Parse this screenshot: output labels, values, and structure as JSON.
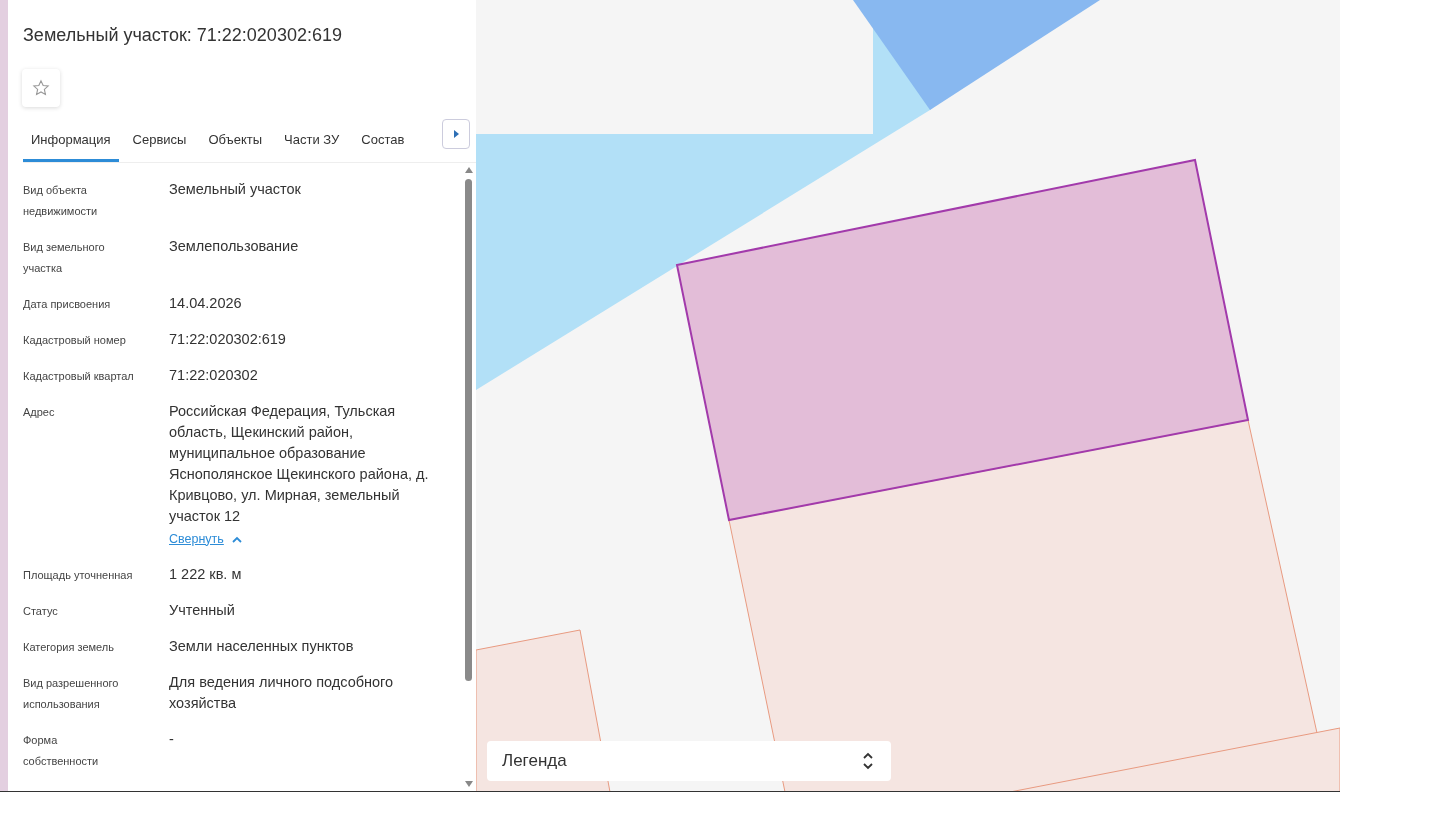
{
  "panel": {
    "title": "Земельный участок: 71:22:020302:619",
    "tabs": [
      {
        "label": "Информация",
        "selected": true
      },
      {
        "label": "Сервисы",
        "selected": false
      },
      {
        "label": "Объекты",
        "selected": false
      },
      {
        "label": "Части ЗУ",
        "selected": false
      },
      {
        "label": "Состав",
        "selected": false
      }
    ],
    "fields": [
      {
        "kind": "plain",
        "label": "Вид объекта недвижимости",
        "value": "Земельный участок"
      },
      {
        "kind": "plain",
        "label": "Вид земельного участка",
        "value": "Землепользование"
      },
      {
        "kind": "plain",
        "label": "Дата присвоения",
        "value": "14.04.2026"
      },
      {
        "kind": "plain",
        "label": "Кадастровый номер",
        "value": "71:22:020302:619"
      },
      {
        "kind": "plain",
        "label": "Кадастровый квартал",
        "value": "71:22:020302"
      },
      {
        "kind": "expandable",
        "label": "Адрес",
        "value": "Российская Федерация, Тульская область, Щекинский район, муниципальное образование Яснополянское Щекинского района, д. Кривцово, ул. Мирная, земельный участок 12",
        "toggle": "Свернуть",
        "expanded": true
      },
      {
        "kind": "plain",
        "label": "Площадь уточненная",
        "value": "1 222 кв. м"
      },
      {
        "kind": "plain",
        "label": "Статус",
        "value": "Учтенный"
      },
      {
        "kind": "plain",
        "label": "Категория земель",
        "value": "Земли населенных пунктов"
      },
      {
        "kind": "plain",
        "label": "Вид разрешенного использования",
        "value": "Для ведения личного подсобного хозяйства"
      },
      {
        "kind": "plain",
        "label": "Форма собственности",
        "value": "-"
      }
    ]
  },
  "legend": {
    "label": "Легенда"
  }
}
